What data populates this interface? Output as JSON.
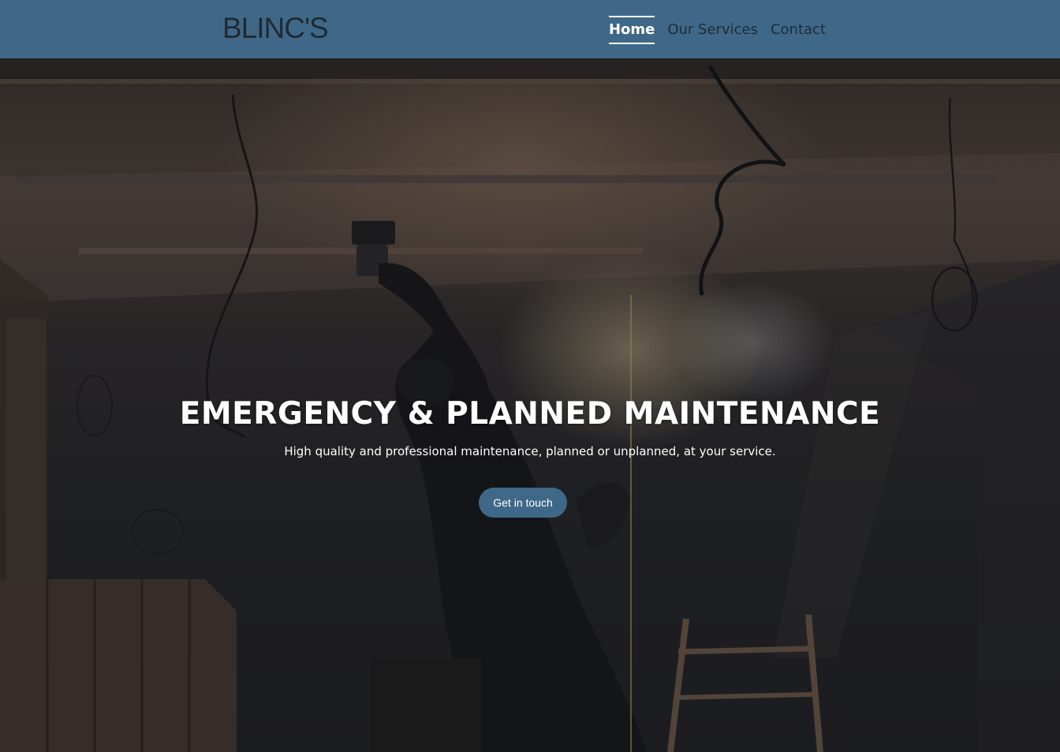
{
  "brand": {
    "logo_text": "BLINC'S",
    "accent_color": "#3f6888"
  },
  "nav": {
    "items": [
      {
        "label": "Home",
        "active": true
      },
      {
        "label": "Our Services",
        "active": false
      },
      {
        "label": "Contact",
        "active": false
      }
    ]
  },
  "hero": {
    "title": "EMERGENCY & PLANNED MAINTENANCE",
    "subtitle": "High quality and professional maintenance, planned or unplanned, at your service.",
    "cta_label": "Get in touch",
    "background": "construction-worker-photo"
  }
}
